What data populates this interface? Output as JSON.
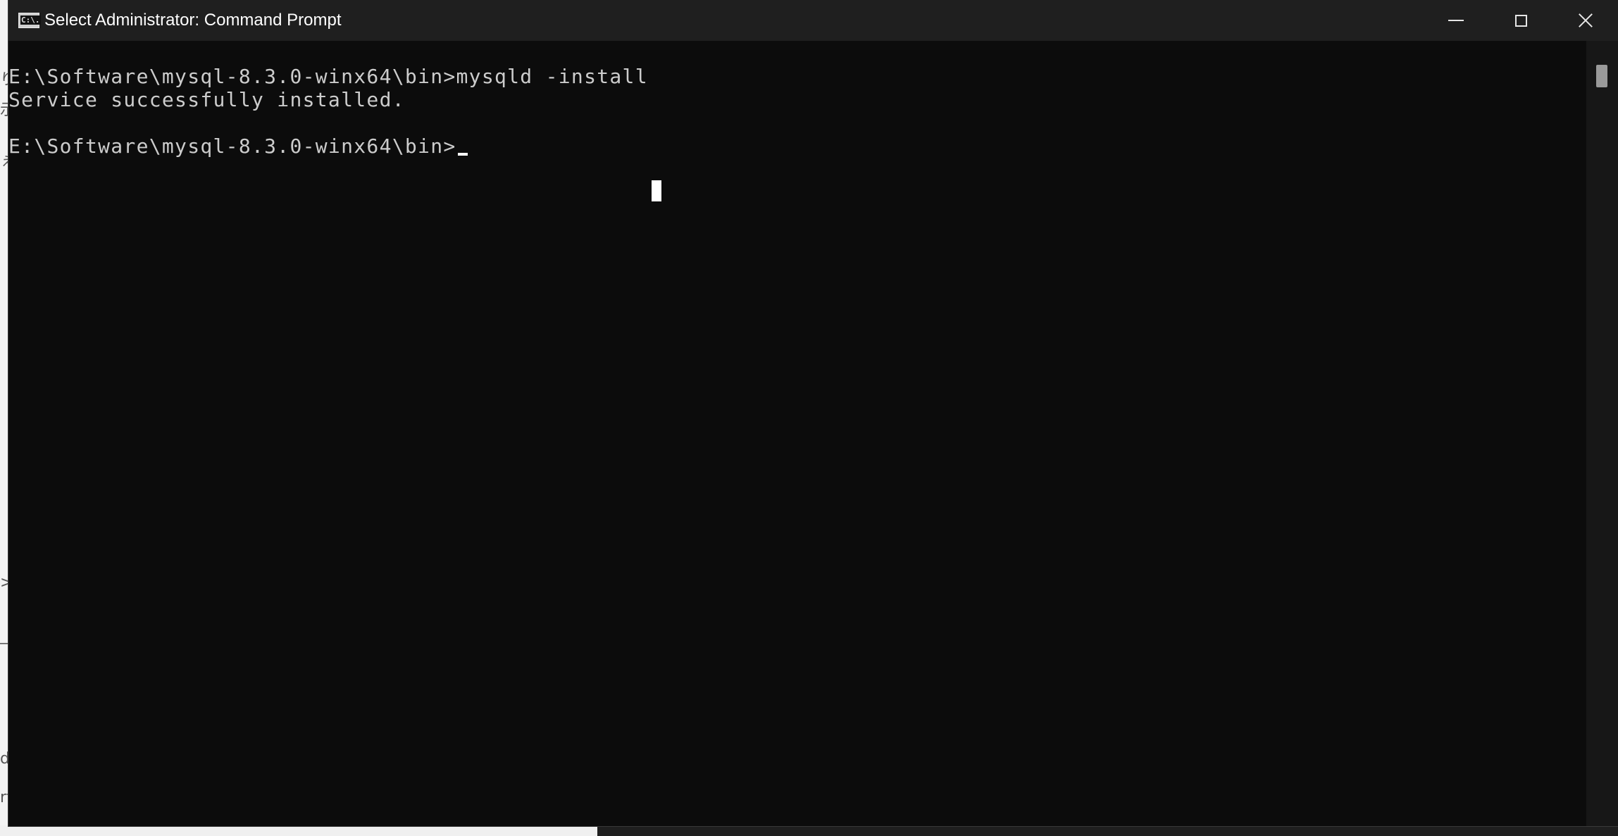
{
  "window": {
    "title": "Select Administrator: Command Prompt",
    "icon": "cmd-icon",
    "controls": {
      "minimize": "minimize-icon",
      "maximize": "maximize-icon",
      "close": "close-icon"
    }
  },
  "console": {
    "lines": [
      "E:\\Software\\mysql-8.3.0-winx64\\bin>mysqld -install",
      "Service successfully installed.",
      "",
      "E:\\Software\\mysql-8.3.0-winx64\\bin>"
    ],
    "text_color": "#cccccc",
    "background_color": "#0c0c0c"
  },
  "background_app": {
    "glyphs": [
      "り",
      "示",
      "ぇ",
      ">",
      "_t",
      "de",
      "rt."
    ]
  }
}
